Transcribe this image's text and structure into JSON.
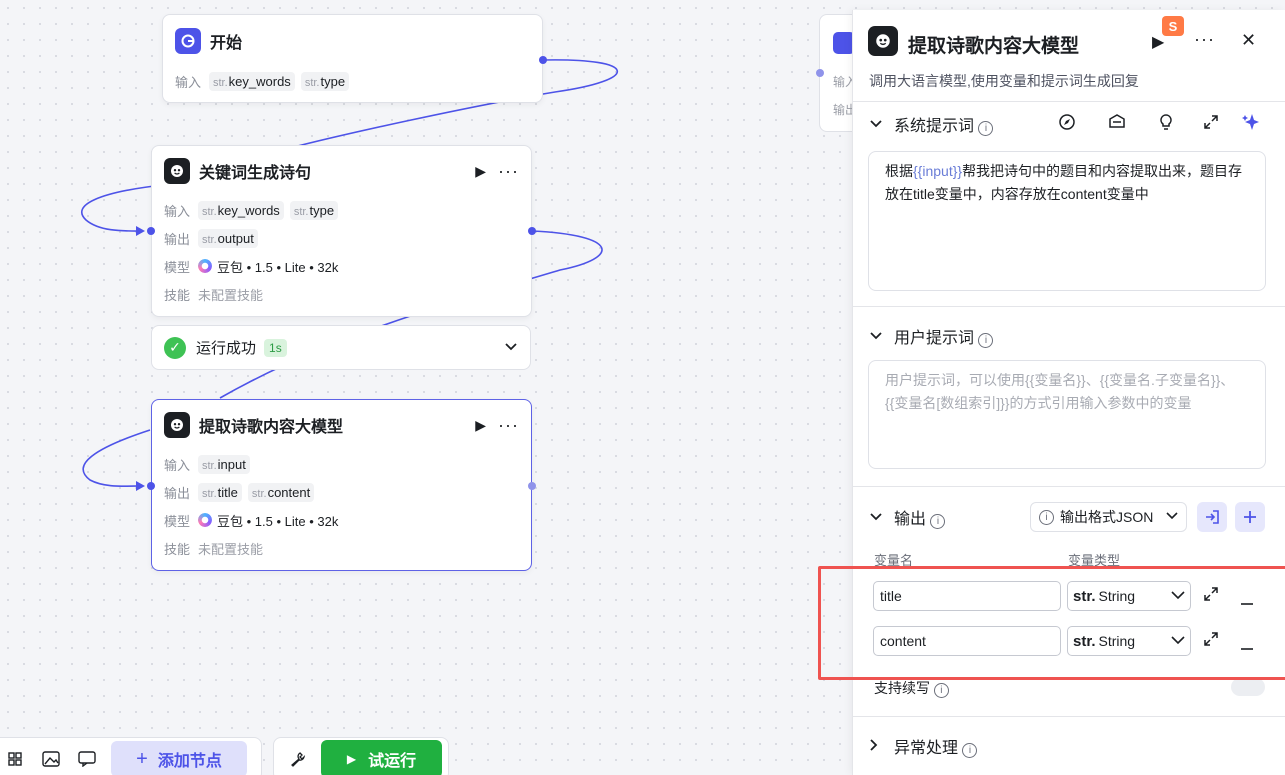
{
  "nodes": {
    "start": {
      "title": "开始",
      "input_label": "输入",
      "inputs": [
        {
          "prefix": "str.",
          "name": "key_words"
        },
        {
          "prefix": "str.",
          "name": "type"
        }
      ]
    },
    "keyword": {
      "title": "关键词生成诗句",
      "input_label": "输入",
      "inputs": [
        {
          "prefix": "str.",
          "name": "key_words"
        },
        {
          "prefix": "str.",
          "name": "type"
        }
      ],
      "output_label": "输出",
      "outputs": [
        {
          "prefix": "str.",
          "name": "output"
        }
      ],
      "model_label": "模型",
      "model": "豆包 • 1.5 • Lite • 32k",
      "skill_label": "技能",
      "skill_value": "未配置技能",
      "run_icon": "▶",
      "more_icon": "···"
    },
    "run_status": {
      "text": "运行成功",
      "time": "1s"
    },
    "extract": {
      "title": "提取诗歌内容大模型",
      "input_label": "输入",
      "inputs": [
        {
          "prefix": "str.",
          "name": "input"
        }
      ],
      "output_label": "输出",
      "outputs": [
        {
          "prefix": "str.",
          "name": "title"
        },
        {
          "prefix": "str.",
          "name": "content"
        }
      ],
      "model_label": "模型",
      "model": "豆包 • 1.5 • Lite • 32k",
      "skill_label": "技能",
      "skill_value": "未配置技能",
      "run_icon": "▶",
      "more_icon": "···"
    },
    "ghost": {
      "input_label": "输入",
      "output_label": "输出"
    }
  },
  "toolbar": {
    "add_node": "添加节点",
    "add_node_icon": "+",
    "test_run": "试运行",
    "test_run_icon": "▶"
  },
  "panel": {
    "title": "提取诗歌内容大模型",
    "description": "调用大语言模型,使用变量和提示词生成回复",
    "logo_text": "S",
    "run_icon": "▶",
    "more_icon": "···",
    "close_icon": "✕",
    "system_prompt": {
      "label": "系统提示词",
      "text_before": "根据",
      "variable": "{{input}}",
      "text_after": "帮我把诗句中的题目和内容提取出来，题目存放在title变量中，内容存放在content变量中"
    },
    "user_prompt": {
      "label": "用户提示词",
      "placeholder": "用户提示词，可以使用{{变量名}}、{{变量名.子变量名}}、{{变量名[数组索引]}}的方式引用输入参数中的变量"
    },
    "output": {
      "label": "输出",
      "format": "输出格式JSON",
      "column_name": "变量名",
      "column_type": "变量类型",
      "rows": [
        {
          "name": "title",
          "type_prefix": "str.",
          "type": "String"
        },
        {
          "name": "content",
          "type_prefix": "str.",
          "type": "String"
        }
      ],
      "streaming_label": "支持续写"
    },
    "exception": {
      "label": "异常处理"
    }
  },
  "colors": {
    "accent": "#4d53e8",
    "success": "#20b040",
    "highlight": "#ef5350"
  }
}
